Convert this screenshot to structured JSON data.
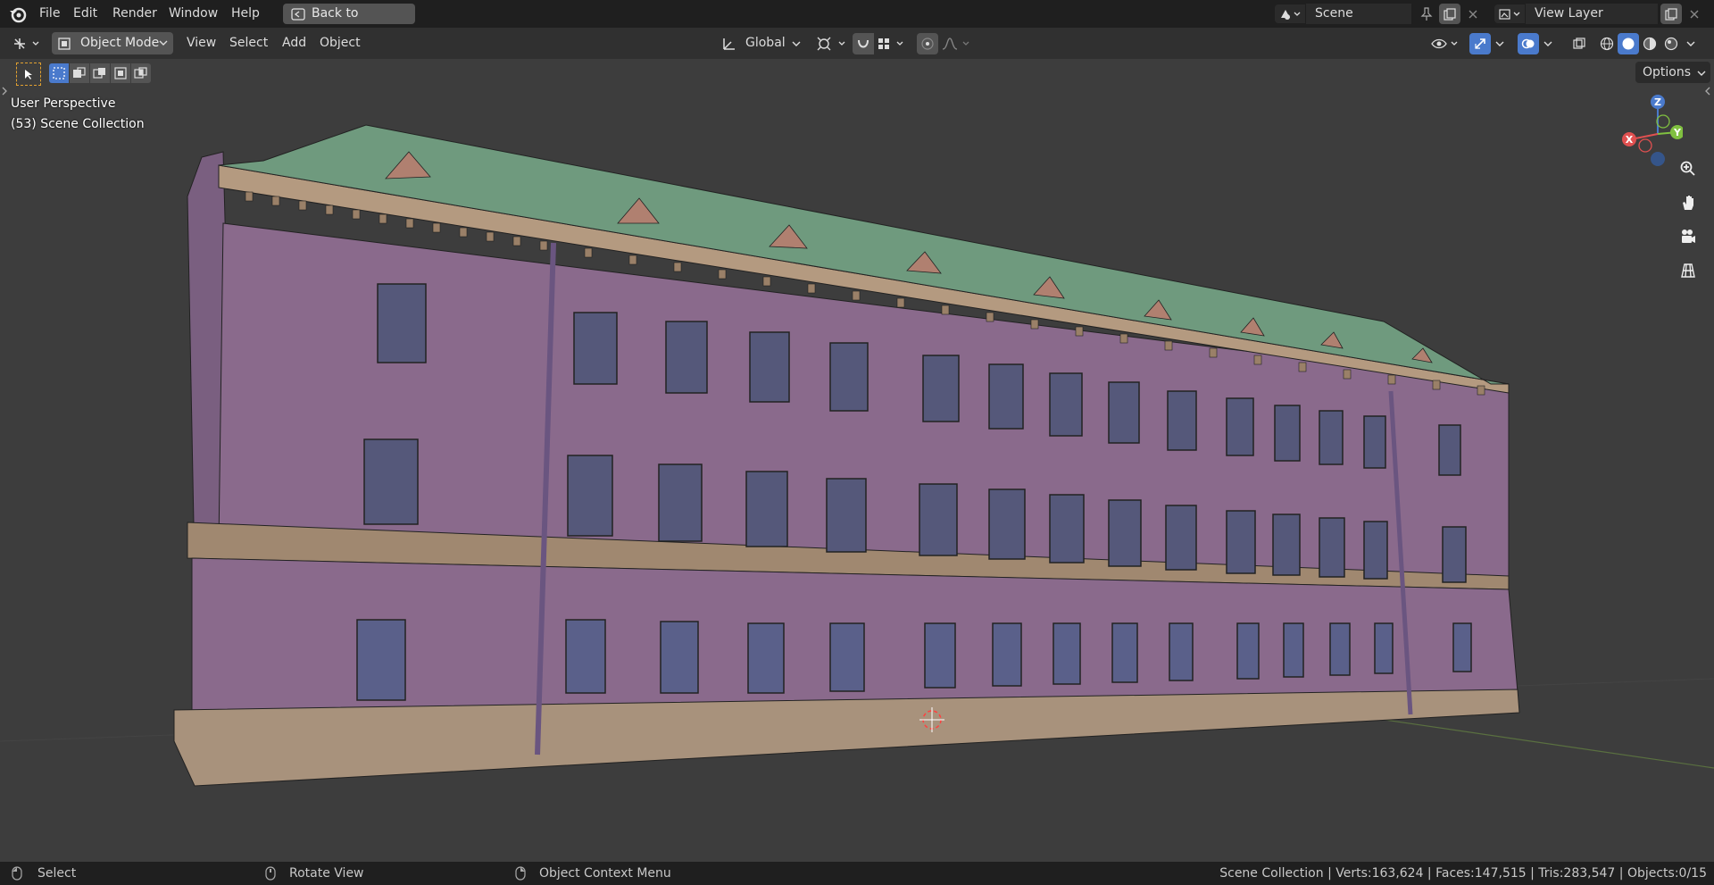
{
  "menubar": {
    "items": [
      "File",
      "Edit",
      "Render",
      "Window",
      "Help"
    ],
    "back_label": "Back to Previous",
    "scene_value": "Scene",
    "view_layer_value": "View Layer"
  },
  "header": {
    "mode_label": "Object Mode",
    "menus": [
      "View",
      "Select",
      "Add",
      "Object"
    ],
    "orientation_label": "Global"
  },
  "toolrow": {
    "options_label": "Options"
  },
  "viewport": {
    "perspective_label": "User Perspective",
    "collection_label": "(53) Scene Collection",
    "gizmo": {
      "x": "X",
      "y": "Y",
      "z": "Z"
    }
  },
  "statusbar": {
    "select_label": "Select",
    "rotate_label": "Rotate View",
    "context_label": "Object Context Menu",
    "stats": "Scene Collection | Verts:163,624 | Faces:147,515 | Tris:283,547 | Objects:0/15"
  },
  "colors": {
    "wall": "#8a6a8c",
    "roof": "#6f9a7e",
    "base": "#a8927c",
    "accent_blue": "#4a7acc"
  }
}
